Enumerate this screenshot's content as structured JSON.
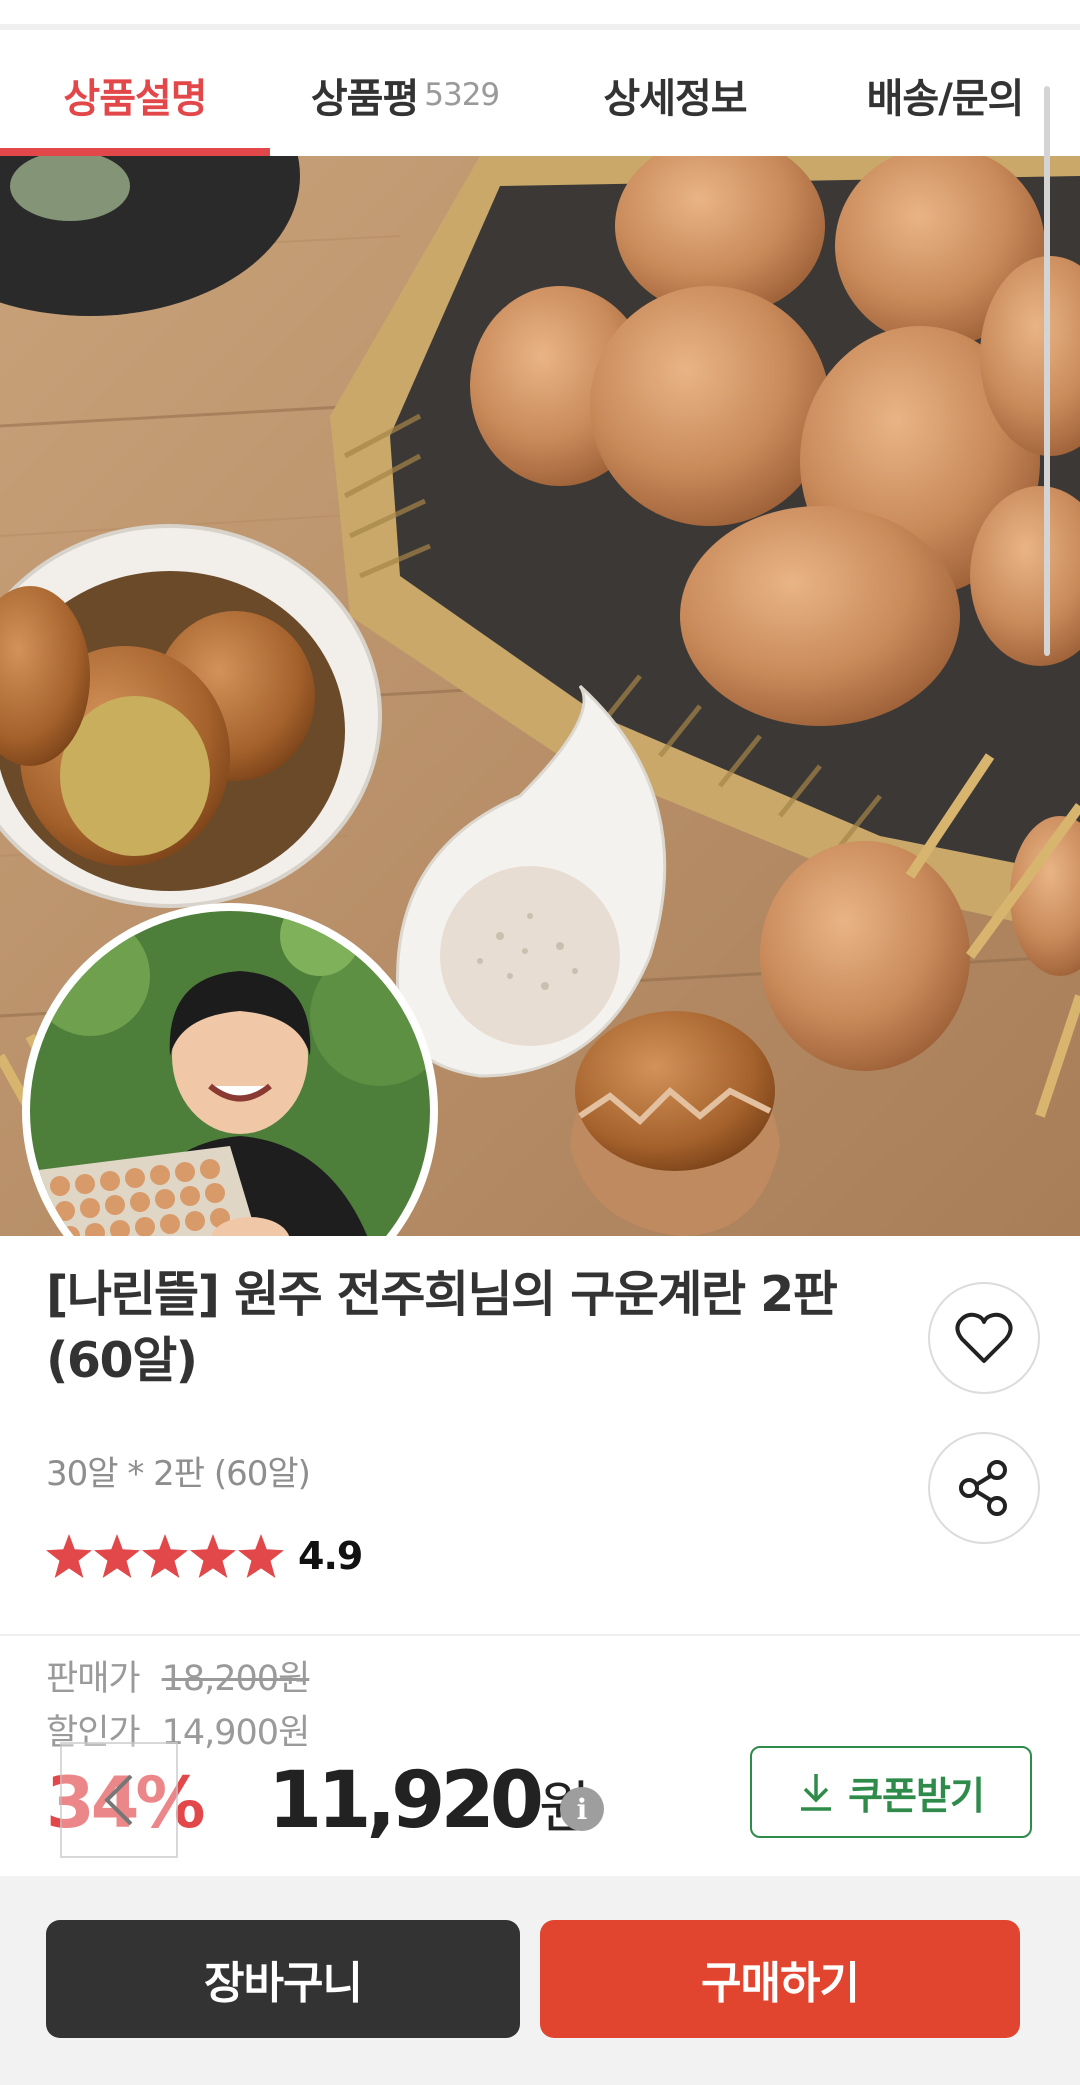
{
  "tabs": [
    {
      "label": "상품설명",
      "active": true
    },
    {
      "label": "상품평",
      "count": "5329"
    },
    {
      "label": "상세정보"
    },
    {
      "label": "배송/문의"
    }
  ],
  "product": {
    "title": "[나린뜰] 원주 전주희님의 구운계란 2판(60알)",
    "option": "30알 * 2판 (60알)",
    "rating": "4.9",
    "stars": 5
  },
  "price": {
    "sale_label": "판매가",
    "sale_value": "18,200원",
    "discount_label": "할인가",
    "discount_value": "14,900원",
    "discount_percent": "34%",
    "final_amount": "11,920",
    "final_unit": "원",
    "info_icon": "i"
  },
  "buttons": {
    "coupon": "쿠폰받기",
    "cart": "장바구니",
    "buy": "구매하기"
  },
  "icons": {
    "wishlist": "heart-icon",
    "share": "share-icon",
    "download": "download-icon",
    "back": "chevron-left-icon",
    "info": "info-icon"
  },
  "colors": {
    "accent": "#e2474a",
    "buy": "#e2452f",
    "cart": "#333333",
    "coupon": "#2e8b4a"
  }
}
